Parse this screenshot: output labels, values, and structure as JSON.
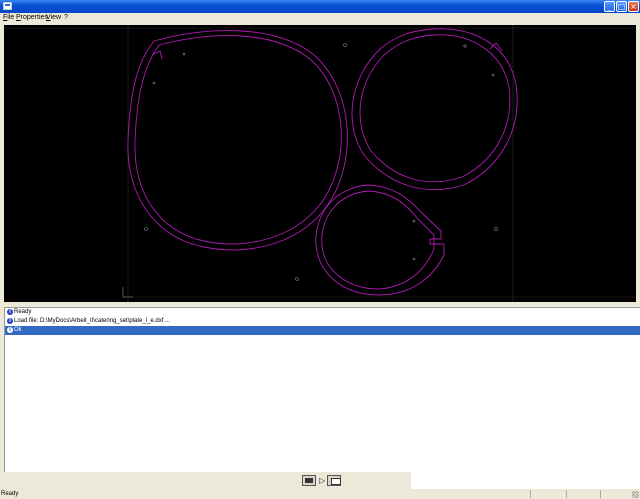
{
  "titlebar": {
    "title": "",
    "icons": {
      "app": "app-icon",
      "minimize": "minimize-icon",
      "maximize": "maximize-icon",
      "close": "close-icon"
    }
  },
  "menu": {
    "items": [
      "File",
      "Properties",
      "View",
      "?"
    ]
  },
  "colors": {
    "canvas_bg": "#000000",
    "contour": "#b01ab5",
    "guide": "#666666",
    "selection": "#316ac5",
    "titlebar": "#0a52d8"
  },
  "log": {
    "rows": [
      {
        "icon": "info-icon",
        "text": "Ready",
        "selected": false
      },
      {
        "icon": "info-icon",
        "text": "Load file: D:\\MyDocs\\Arbeit_II\\catering_set\\plate_l_e.dxf ...",
        "selected": false
      },
      {
        "icon": "info-icon",
        "text": "Ok",
        "selected": true
      }
    ]
  },
  "toolstrip": {
    "icons": [
      "view-screen-icon",
      "play-icon",
      "output-screen-icon"
    ]
  },
  "status": {
    "text": "Ready"
  }
}
